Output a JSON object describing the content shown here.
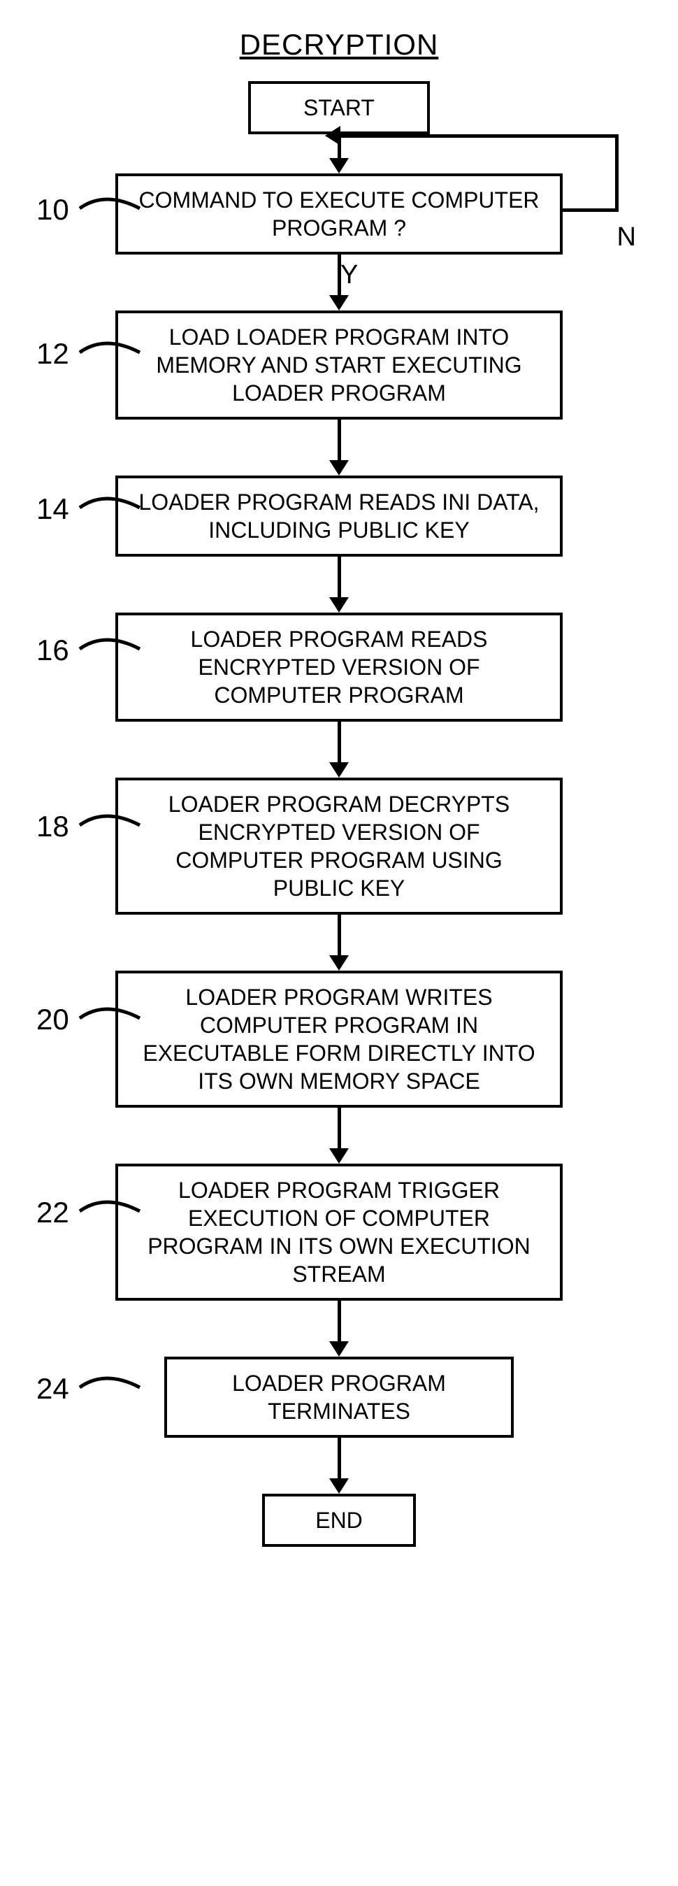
{
  "title": "DECRYPTION",
  "start": "START",
  "end": "END",
  "yes_label": "Y",
  "no_label": "N",
  "steps": {
    "s10": {
      "num": "10",
      "text": "COMMAND TO EXECUTE COMPUTER PROGRAM ?"
    },
    "s12": {
      "num": "12",
      "text": "LOAD LOADER PROGRAM INTO MEMORY AND START EXECUTING LOADER PROGRAM"
    },
    "s14": {
      "num": "14",
      "text": "LOADER PROGRAM READS INI DATA, INCLUDING PUBLIC KEY"
    },
    "s16": {
      "num": "16",
      "text": "LOADER PROGRAM READS ENCRYPTED VERSION OF COMPUTER PROGRAM"
    },
    "s18": {
      "num": "18",
      "text": "LOADER PROGRAM DECRYPTS ENCRYPTED VERSION OF COMPUTER PROGRAM USING PUBLIC KEY"
    },
    "s20": {
      "num": "20",
      "text": "LOADER PROGRAM WRITES COMPUTER PROGRAM IN EXECUTABLE FORM DIRECTLY INTO ITS OWN MEMORY SPACE"
    },
    "s22": {
      "num": "22",
      "text": "LOADER PROGRAM TRIGGER EXECUTION OF COMPUTER PROGRAM IN ITS OWN EXECUTION STREAM"
    },
    "s24": {
      "num": "24",
      "text": "LOADER PROGRAM TERMINATES"
    }
  }
}
